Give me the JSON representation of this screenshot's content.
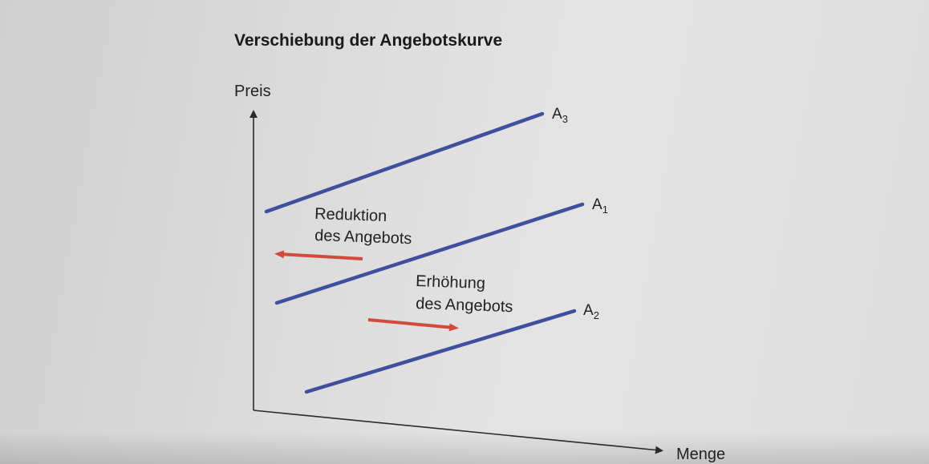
{
  "title": "Verschiebung der Angebotskurve",
  "axes": {
    "y_label": "Preis",
    "x_label": "Menge"
  },
  "colors": {
    "curve": "#3f4f9e",
    "shift_arrow": "#d24a3b",
    "axis": "#2a2a2a"
  },
  "curves": [
    {
      "id": "A3",
      "letter": "A",
      "subscript": "3"
    },
    {
      "id": "A1",
      "letter": "A",
      "subscript": "1"
    },
    {
      "id": "A2",
      "letter": "A",
      "subscript": "2"
    }
  ],
  "annotations": {
    "reduction": {
      "line1": "Reduktion",
      "line2": "des Angebots",
      "direction": "left"
    },
    "increase": {
      "line1": "Erhöhung",
      "line2": "des Angebots",
      "direction": "right"
    }
  }
}
